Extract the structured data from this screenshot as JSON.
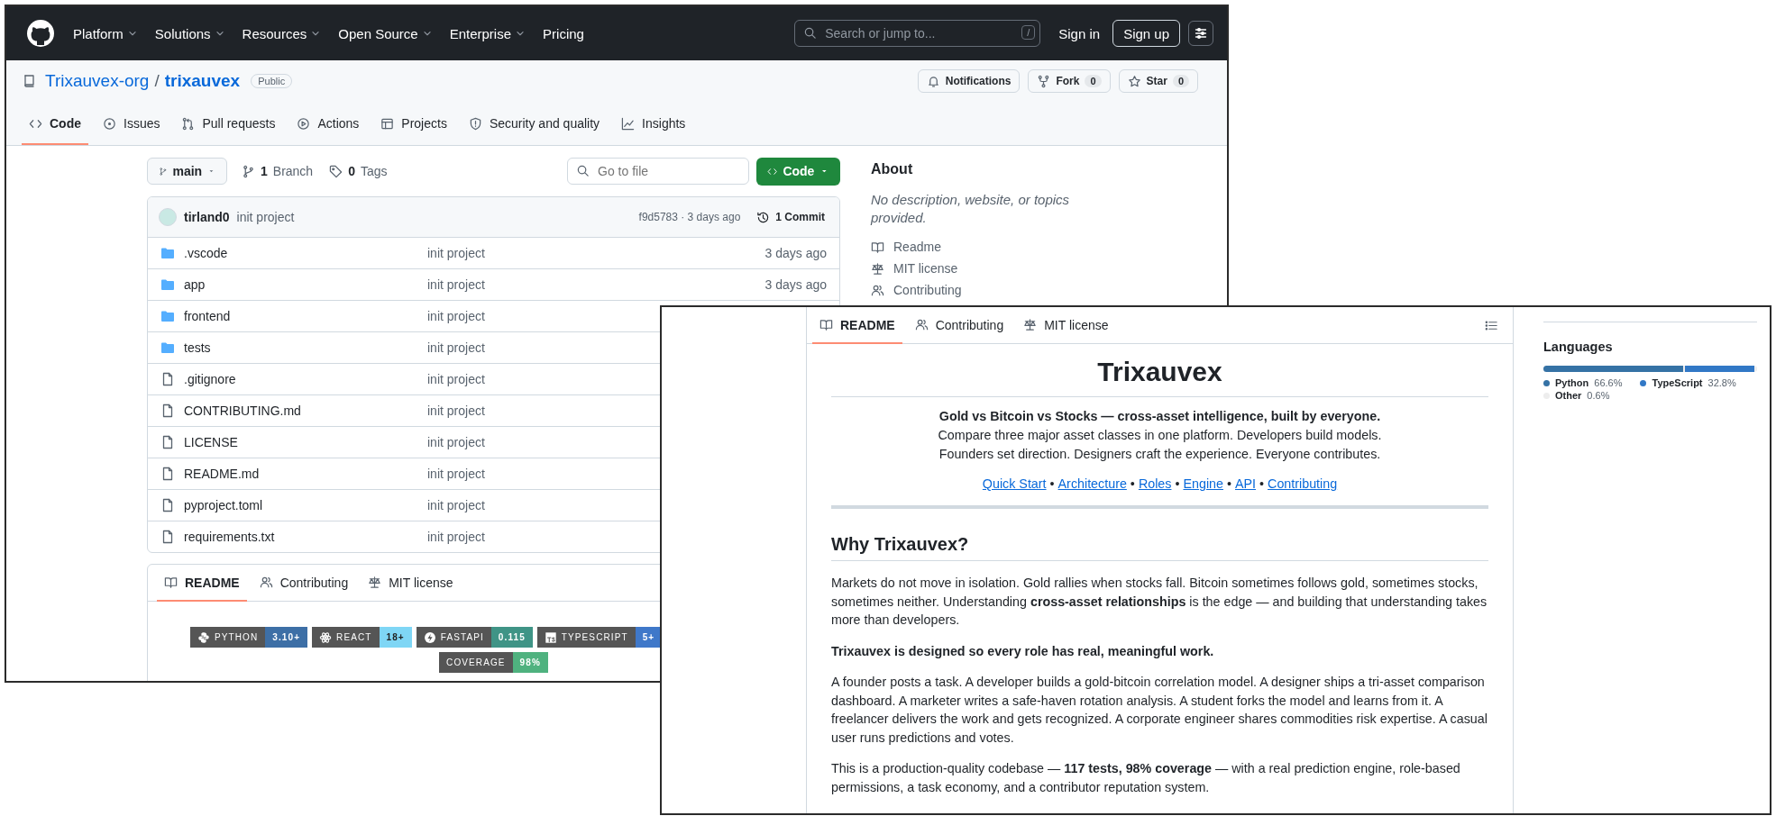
{
  "repo_window": {
    "top_nav": {
      "menus": [
        {
          "label": "Platform",
          "dropdown": true
        },
        {
          "label": "Solutions",
          "dropdown": true
        },
        {
          "label": "Resources",
          "dropdown": true
        },
        {
          "label": "Open Source",
          "dropdown": true
        },
        {
          "label": "Enterprise",
          "dropdown": true
        },
        {
          "label": "Pricing",
          "dropdown": false
        }
      ],
      "search": {
        "placeholder": "Search or jump to...",
        "shortcut": "/"
      },
      "sign_in": "Sign in",
      "sign_up": "Sign up"
    },
    "repo_header": {
      "owner": "Trixauvex-org",
      "separator": "/",
      "name": "trixauvex",
      "visibility": "Public",
      "actions": [
        {
          "label": "Notifications"
        },
        {
          "label": "Fork",
          "count": "0"
        },
        {
          "label": "Star",
          "count": "0"
        }
      ]
    },
    "tabs": [
      {
        "label": "Code",
        "selected": true
      },
      {
        "label": "Issues",
        "selected": false
      },
      {
        "label": "Pull requests",
        "selected": false
      },
      {
        "label": "Actions",
        "selected": false
      },
      {
        "label": "Projects",
        "selected": false
      },
      {
        "label": "Security and quality",
        "selected": false
      },
      {
        "label": "Insights",
        "selected": false
      }
    ],
    "toolbar": {
      "branch": "main",
      "branch_count": "1",
      "branch_label": "Branch",
      "tag_count": "0",
      "tag_label": "Tags",
      "file_search": {
        "placeholder": "Go to file"
      },
      "code_button": "Code"
    },
    "latest_commit": {
      "author": "tirland0",
      "message": "init project",
      "info": "f9d5783 · 3 days ago",
      "commits": "1 Commit"
    },
    "files": [
      {
        "kind": "folder",
        "name": ".vscode",
        "message": "init project",
        "age": "3 days ago"
      },
      {
        "kind": "folder",
        "name": "app",
        "message": "init project",
        "age": "3 days ago"
      },
      {
        "kind": "folder",
        "name": "frontend",
        "message": "init project"
      },
      {
        "kind": "folder",
        "name": "tests",
        "message": "init project"
      },
      {
        "kind": "file",
        "name": ".gitignore",
        "message": "init project"
      },
      {
        "kind": "file",
        "name": "CONTRIBUTING.md",
        "message": "init project"
      },
      {
        "kind": "file",
        "name": "LICENSE",
        "message": "init project"
      },
      {
        "kind": "file",
        "name": "README.md",
        "message": "init project"
      },
      {
        "kind": "file",
        "name": "pyproject.toml",
        "message": "init project"
      },
      {
        "kind": "file",
        "name": "requirements.txt",
        "message": "init project"
      }
    ],
    "readme_tabs": [
      {
        "label": "README",
        "selected": true
      },
      {
        "label": "Contributing",
        "selected": false
      },
      {
        "label": "MIT license",
        "selected": false
      }
    ],
    "badges": [
      {
        "kind": "python",
        "label": "PYTHON",
        "value": "3.10+",
        "color": "#3d6fa6"
      },
      {
        "kind": "react",
        "label": "REACT",
        "value": "18+",
        "color": "#7fd6f5"
      },
      {
        "kind": "fastapi",
        "label": "FASTAPI",
        "value": "0.115",
        "color": "#3f9486"
      },
      {
        "kind": "typescript",
        "label": "TYPESCRIPT",
        "value": "5+",
        "color": "#3f78c9"
      },
      {
        "kind": "plain",
        "label": "COVERAGE",
        "value": "98%",
        "color": "#4fb27f"
      }
    ],
    "about": {
      "title": "About",
      "description": "No description, website, or topics provided.",
      "links": [
        {
          "label": "Readme"
        },
        {
          "label": "MIT license"
        },
        {
          "label": "Contributing"
        }
      ]
    }
  },
  "readme_window": {
    "tabs": [
      {
        "label": "README",
        "selected": true
      },
      {
        "label": "Contributing",
        "selected": false
      },
      {
        "label": "MIT license",
        "selected": false
      }
    ],
    "title": "Trixauvex",
    "tagline": "Gold vs Bitcoin vs Stocks — cross-asset intelligence, built by everyone.",
    "summary_lines": [
      "Compare three major asset classes in one platform. Developers build models.",
      "Founders set direction. Designers craft the experience. Everyone contributes."
    ],
    "links": [
      {
        "label": "Quick Start"
      },
      {
        "label": "Architecture"
      },
      {
        "label": "Roles"
      },
      {
        "label": "Engine"
      },
      {
        "label": "API"
      },
      {
        "label": "Contributing"
      }
    ],
    "link_separator": "•",
    "section_heading": "Why Trixauvex?",
    "paragraphs": [
      {
        "bold": false,
        "text": "Markets do not move in isolation. Gold rallies when stocks fall. Bitcoin sometimes follows gold, sometimes stocks, sometimes neither. Understanding **cross-asset relationships** is the edge — and building that understanding takes more than developers."
      },
      {
        "bold": true,
        "text": "Trixauvex is designed so every role has real, meaningful work."
      },
      {
        "bold": false,
        "text": "A founder posts a task. A developer builds a gold-bitcoin correlation model. A designer ships a tri-asset comparison dashboard. A marketer writes a safe-haven rotation analysis. A student forks the model and learns from it. A freelancer delivers the work and gets recognized. A corporate engineer shares commodities risk expertise. A casual user runs predictions and votes."
      },
      {
        "bold": false,
        "text": "This is a production-quality codebase — **117 tests, 98% coverage** — with a real prediction engine, role-based permissions, a task economy, and a contributor reputation system."
      }
    ],
    "languages_title": "Languages",
    "languages": [
      {
        "name": "Python",
        "percent": "66.6%",
        "level": 0.666,
        "color": "#3572a5"
      },
      {
        "name": "TypeScript",
        "percent": "32.8%",
        "level": 0.328,
        "color": "#3178c6"
      },
      {
        "name": "Other",
        "percent": "0.6%",
        "level": 0.006,
        "color": "#ededed"
      }
    ]
  }
}
